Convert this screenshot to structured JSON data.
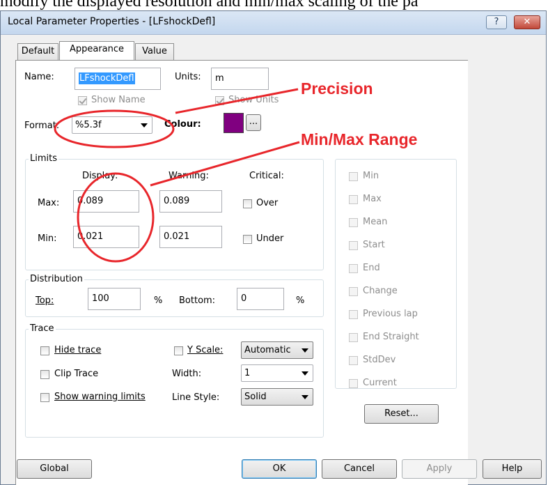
{
  "caption_text": "modify the displayed resolution and min/max scaling of the pa",
  "window": {
    "title": "Local Parameter Properties - [LFshockDefl]",
    "help_btn": "?",
    "close_btn": "✕"
  },
  "tabs": [
    "Default",
    "Appearance",
    "Value"
  ],
  "name_label": "Name:",
  "name_value": "LFshockDefl",
  "units_label": "Units:",
  "units_value": "m",
  "show_name": "Show Name",
  "show_units": "Show Units",
  "format_label": "Format:",
  "format_value": "%5.3f",
  "colour_label": "Colour:",
  "colour_value": "#800080",
  "colour_btn": "...",
  "limits": {
    "title": "Limits",
    "display": "Display:",
    "warning": "Warning:",
    "critical": "Critical:",
    "max_label": "Max:",
    "min_label": "Min:",
    "max_display": "0.089",
    "max_warning": "0.089",
    "min_display": "0.021",
    "min_warning": "0.021",
    "over": "Over",
    "under": "Under"
  },
  "distribution": {
    "title": "Distribution",
    "top_label": "Top:",
    "top_value": "100",
    "pct1": "%",
    "bottom_label": "Bottom:",
    "bottom_value": "0",
    "pct2": "%"
  },
  "trace": {
    "title": "Trace",
    "hide": "Hide trace",
    "clip": "Clip Trace",
    "show_limits": "Show warning limits",
    "yscale": "Y Scale:",
    "yscale_value": "Automatic",
    "width": "Width:",
    "width_value": "1",
    "linestyle": "Line Style:",
    "linestyle_value": "Solid"
  },
  "stats": [
    "Min",
    "Max",
    "Mean",
    "Start",
    "End",
    "Change",
    "Previous lap",
    "End Straight",
    "StdDev",
    "Current"
  ],
  "reset": "Reset...",
  "buttons": {
    "global": "Global",
    "ok": "OK",
    "cancel": "Cancel",
    "apply": "Apply",
    "help": "Help"
  },
  "annotations": {
    "precision": "Precision",
    "minmax": "Min/Max Range"
  },
  "annotation_color": "#e8262b"
}
